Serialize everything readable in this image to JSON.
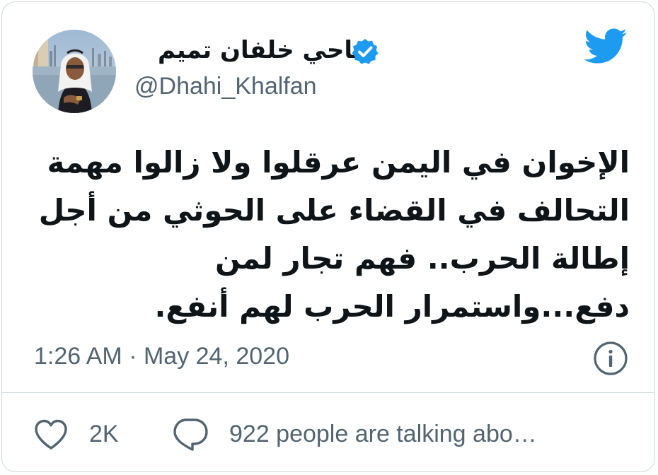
{
  "author": {
    "display_name": "ضاحي خلفان تميم",
    "handle": "@Dhahi_Khalfan",
    "verified": true
  },
  "tweet": {
    "text": "الإخوان في اليمن عرقلوا ولا زالوا مهمة التحالف في القضاء على الحوثي من أجل إطالة الحرب.. فهم تجار لمن دفع...واستمرار الحرب لهم أنفع."
  },
  "meta": {
    "timestamp": "1:26 AM · May 24, 2020"
  },
  "actions": {
    "like_count": "2K",
    "talking_text": "922 people are talking abo…"
  },
  "icons": {
    "brand": "twitter-bird-icon",
    "verified": "verified-badge-icon",
    "info": "info-icon",
    "like": "heart-icon",
    "reply": "reply-icon"
  },
  "colors": {
    "twitter_blue": "#1d9bf0",
    "text_primary": "#0f1419",
    "text_secondary": "#536471",
    "border": "#cfd9de"
  }
}
